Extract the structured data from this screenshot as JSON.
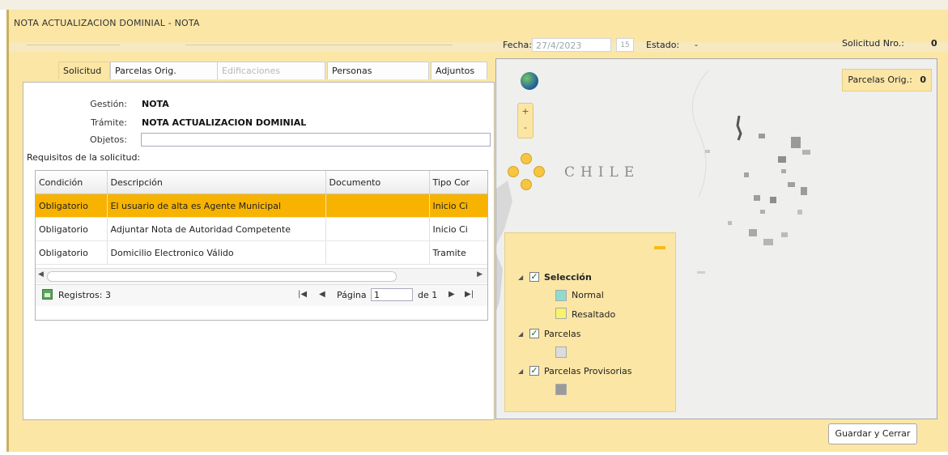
{
  "window": {
    "title": "NOTA ACTUALIZACION DOMINIAL  -  NOTA"
  },
  "tabs": [
    {
      "label": "Solicitud",
      "state": "active"
    },
    {
      "label": "Parcelas Orig.",
      "state": "normal"
    },
    {
      "label": "Edificaciones",
      "state": "disabled"
    },
    {
      "label": "Personas",
      "state": "normal"
    },
    {
      "label": "Adjuntos",
      "state": "normal"
    }
  ],
  "form": {
    "gestion_label": "Gestión:",
    "gestion_value": "NOTA",
    "tramite_label": "Trámite:",
    "tramite_value": "NOTA ACTUALIZACION DOMINIAL",
    "objetos_label": "Objetos:",
    "objetos_value": ""
  },
  "requisitos": {
    "label": "Requisitos de la solicitud:",
    "columns": [
      "Condición",
      "Descripción",
      "Documento",
      "Tipo Cor"
    ],
    "rows": [
      {
        "condicion": "Obligatorio",
        "descripcion": "El usuario de alta es Agente Municipal",
        "documento": "",
        "tipo": "Inicio Ci"
      },
      {
        "condicion": "Obligatorio",
        "descripcion": "Adjuntar Nota de Autoridad Competente",
        "documento": "",
        "tipo": "Inicio Ci"
      },
      {
        "condicion": "Obligatorio",
        "descripcion": "Domicilio Electronico Válido",
        "documento": "",
        "tipo": "Tramite"
      }
    ],
    "selected_row": 0,
    "pager": {
      "records_text": "Registros: 3",
      "page_label": "Página",
      "page_value": "1",
      "of_text": "de 1"
    }
  },
  "header_right": {
    "fecha_label": "Fecha:",
    "fecha_value": "27/4/2023",
    "cal_glyph": "15",
    "estado_label": "Estado:",
    "estado_value": "-",
    "solicitud_label": "Solicitud Nro.:",
    "solicitud_value": "0"
  },
  "map": {
    "country_label": "CHILE",
    "parcelas_label": "Parcelas Orig.:",
    "parcelas_value": "0",
    "zoom_in": "+",
    "zoom_out": "-",
    "legend": {
      "group1": "Selección",
      "group1_items": [
        {
          "label": "Normal",
          "color": "#8fdccf"
        },
        {
          "label": "Resaltado",
          "color": "#f7f36a"
        }
      ],
      "group2": "Parcelas",
      "group2_swatch": "#dcdcdc",
      "group3": "Parcelas Provisorias",
      "group3_swatch": "#9a9a9a"
    }
  },
  "save_button": "Guardar y Cerrar",
  "colors": {
    "accent": "#fbe6a6",
    "selected_row": "#f7b300"
  }
}
